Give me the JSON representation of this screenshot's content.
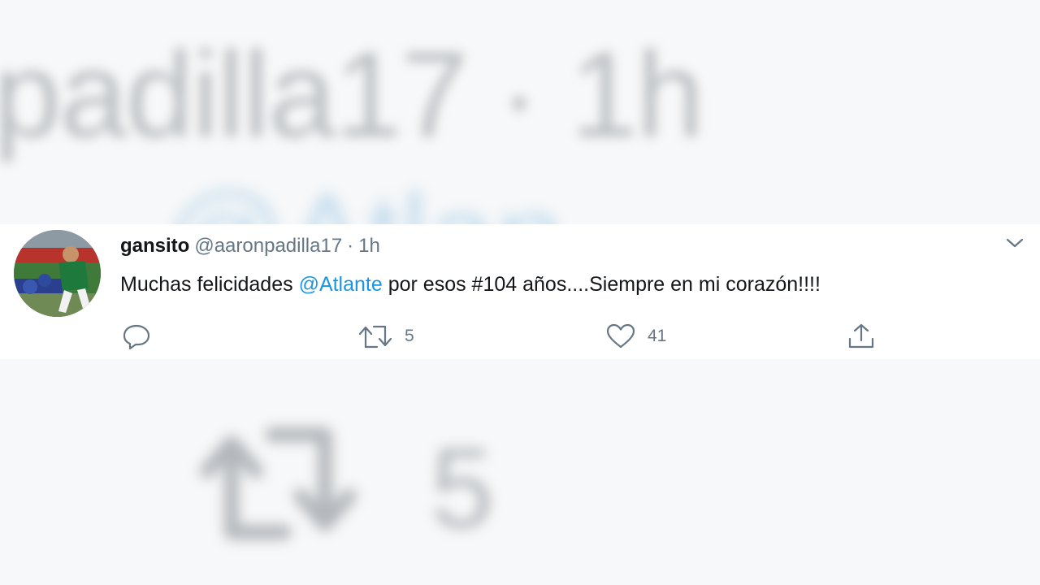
{
  "background": {
    "top_text": "padilla17 · 1h",
    "mention_text": "@Atlan",
    "retweet_count": "5"
  },
  "tweet": {
    "display_name": "gansito",
    "handle": "@aaronpadilla17",
    "separator": "·",
    "time": "1h",
    "text_before": "Muchas felicidades ",
    "mention": "@Atlante",
    "text_after": " por esos #104 años....Siempre en mi corazón!!!!",
    "actions": {
      "reply_count": "",
      "retweet_count": "5",
      "like_count": "41"
    }
  },
  "icons": {
    "reply": "reply-icon",
    "retweet": "retweet-icon",
    "like": "heart-icon",
    "share": "share-icon",
    "menu": "chevron-down-icon"
  },
  "colors": {
    "text": "#14171a",
    "secondary": "#657786",
    "link": "#1b95e0"
  }
}
